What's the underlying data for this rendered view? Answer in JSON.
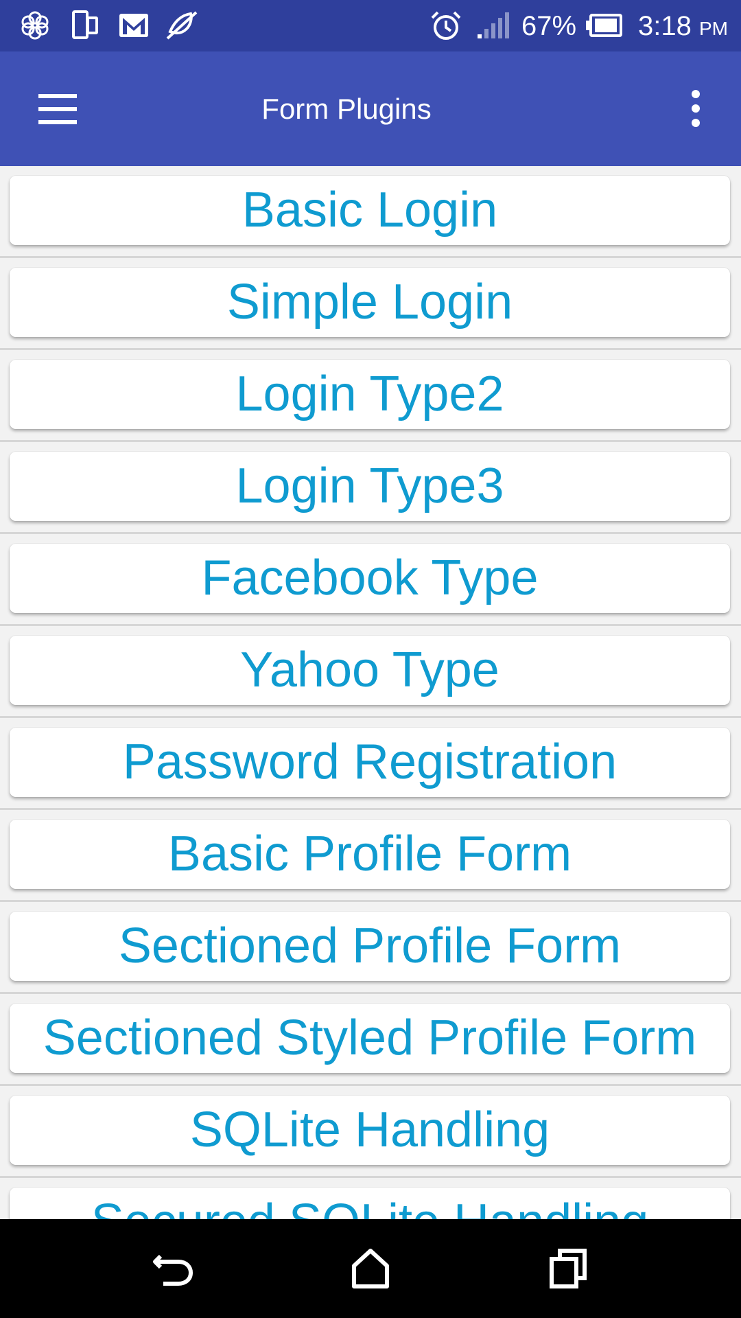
{
  "status_bar": {
    "battery_percent": "67%",
    "time": "3:18",
    "ampm": "PM",
    "icons": [
      "app-icon",
      "phone-icon",
      "gmail-icon",
      "mute-icon",
      "alarm-icon",
      "signal-icon",
      "battery-icon"
    ]
  },
  "app_bar": {
    "title": "Form Plugins",
    "menu_icon": "hamburger-menu-icon",
    "more_icon": "more-vertical-icon"
  },
  "list": {
    "items": [
      {
        "label": "Basic Login"
      },
      {
        "label": "Simple Login"
      },
      {
        "label": "Login Type2"
      },
      {
        "label": "Login Type3"
      },
      {
        "label": "Facebook Type"
      },
      {
        "label": "Yahoo Type"
      },
      {
        "label": "Password Registration"
      },
      {
        "label": "Basic Profile Form"
      },
      {
        "label": "Sectioned Profile Form"
      },
      {
        "label": "Sectioned Styled Profile Form"
      },
      {
        "label": "SQLite Handling"
      },
      {
        "label": "Secured SQLite Handling"
      }
    ]
  },
  "nav_bar": {
    "icons": [
      "back-icon",
      "home-icon",
      "recents-icon"
    ]
  },
  "colors": {
    "status_bar": "#2f3f9c",
    "app_bar": "#3f51b5",
    "item_text": "#0f9bd0",
    "background": "#f2f2f2"
  }
}
